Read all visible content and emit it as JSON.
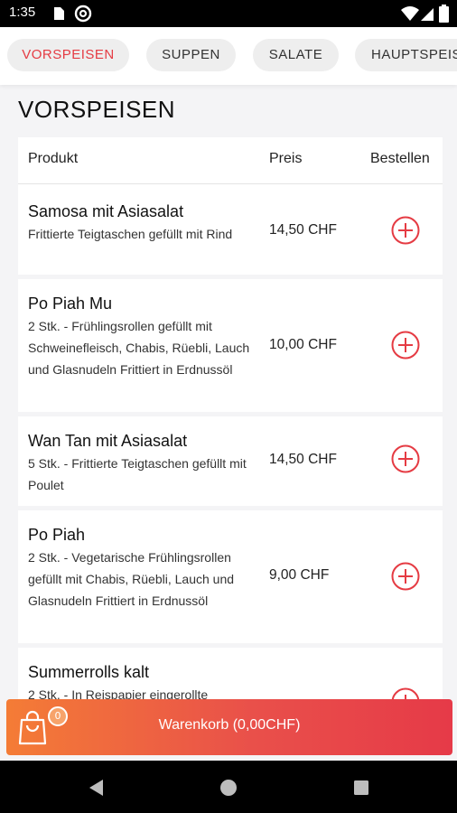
{
  "status_bar": {
    "time": "1:35"
  },
  "tabs": [
    {
      "label": "VORSPEISEN",
      "active": true
    },
    {
      "label": "SUPPEN",
      "active": false
    },
    {
      "label": "SALATE",
      "active": false
    },
    {
      "label": "HAUPTSPEIS",
      "active": false
    }
  ],
  "section_title": "VORSPEISEN",
  "table": {
    "headers": {
      "product": "Produkt",
      "price": "Preis",
      "order": "Bestellen"
    },
    "rows": [
      {
        "name": "Samosa mit Asiasalat",
        "description": "Frittierte Teigtaschen gefüllt mit Rind",
        "price": "14,50 CHF"
      },
      {
        "name": "Po Piah Mu",
        "description": "2 Stk. - Frühlingsrollen gefüllt mit Schweinefleisch, Chabis, Rüebli, Lauch und Glasnudeln Frittiert in Erdnussöl",
        "price": "10,00 CHF"
      },
      {
        "name": "Wan Tan mit Asiasalat",
        "description": "5 Stk. -  Frittierte Teigtaschen gefüllt mit Poulet",
        "price": "14,50 CHF"
      },
      {
        "name": "Po Piah",
        "description": "2 Stk. - Vegetarische Frühlingsrollen gefüllt mit Chabis, Rüebli, Lauch und Glasnudeln Frittiert in Erdnussöl",
        "price": "9,00 CHF"
      },
      {
        "name": "Summerrolls kalt",
        "description": "2 Stk. - In Reispapier eingerollte",
        "price": ""
      }
    ]
  },
  "cart": {
    "label": "Warenkorb (0,00CHF)",
    "count": "0"
  },
  "colors": {
    "accent": "#e53b43",
    "cart_start": "#f47c36",
    "cart_end": "#e63a48"
  },
  "icons": [
    "photo-icon",
    "at-sign-icon",
    "wifi-icon",
    "signal-icon",
    "battery-icon",
    "add-circle-icon",
    "shopping-bag-icon",
    "back-icon",
    "home-icon",
    "recents-icon"
  ]
}
